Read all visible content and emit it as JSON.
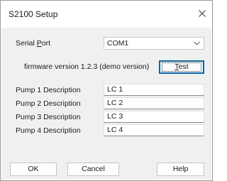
{
  "window": {
    "title": "S2100 Setup"
  },
  "serial_port": {
    "label_prefix": "Serial ",
    "label_accel": "P",
    "label_suffix": "ort",
    "value": "COM1"
  },
  "firmware": {
    "text": "firmware version 1.2.3 (demo version)"
  },
  "test_button": {
    "accel": "T",
    "rest": "est"
  },
  "pumps": [
    {
      "label": "Pump 1 Description",
      "value": "LC 1"
    },
    {
      "label": "Pump 2 Description",
      "value": "LC 2"
    },
    {
      "label": "Pump 3 Description",
      "value": "LC 3"
    },
    {
      "label": "Pump 4 Description",
      "value": "LC 4"
    }
  ],
  "buttons": {
    "ok": "OK",
    "cancel": "Cancel",
    "help": "Help"
  },
  "icons": {
    "close": "close-icon",
    "dropdown": "chevron-down-icon"
  },
  "colors": {
    "accent": "#0067c0",
    "dialog_bg": "#f0f0f0"
  }
}
